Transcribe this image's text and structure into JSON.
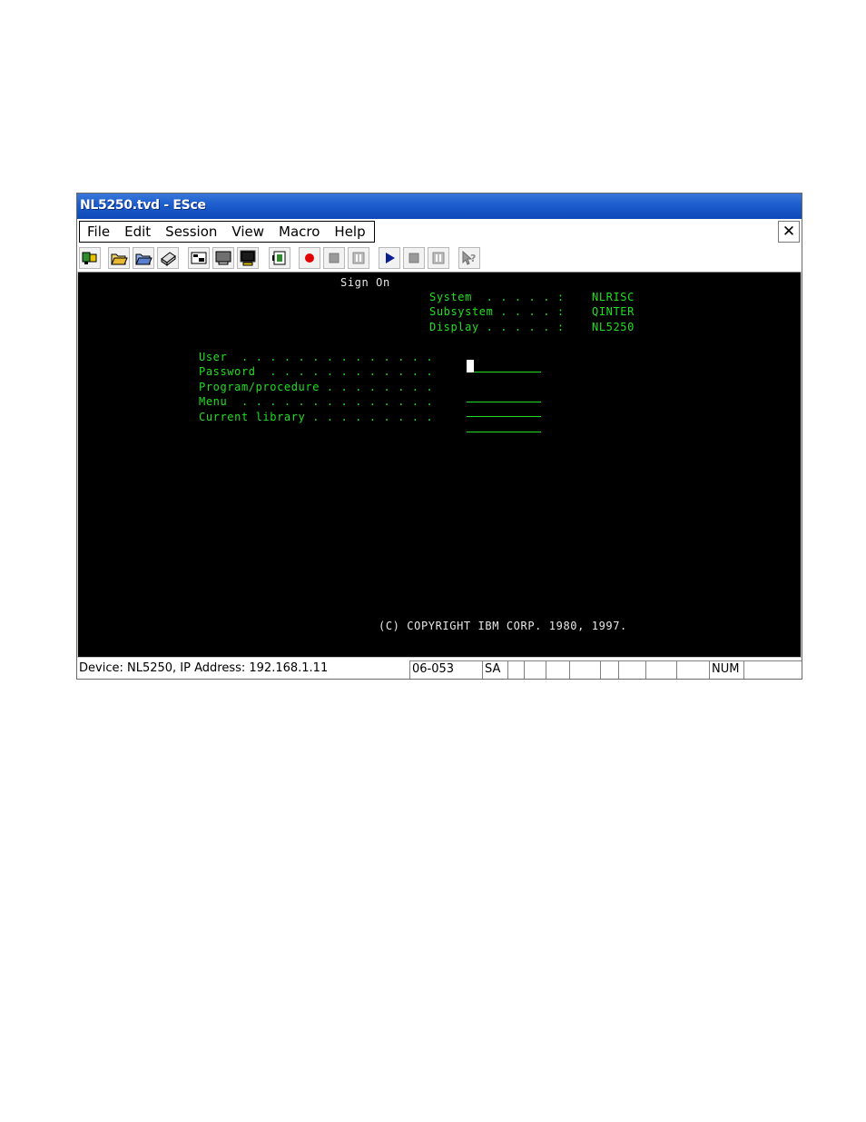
{
  "window": {
    "title": "NL5250.tvd - ESce"
  },
  "menu": {
    "items": [
      "File",
      "Edit",
      "Session",
      "View",
      "Macro",
      "Help"
    ],
    "close_label": "✕"
  },
  "toolbar": {
    "buttons": [
      "connect-icon",
      "open-folder-icon",
      "open-session-icon",
      "print-icon",
      "copy-screen-icon",
      "display-icon",
      "monitor-icon",
      "keyboard-icon",
      "record-icon",
      "stop-record-icon",
      "pause-record-icon",
      "play-icon",
      "stop-icon",
      "pause-icon",
      "help-icon"
    ]
  },
  "terminal": {
    "heading": "Sign On",
    "info": [
      {
        "label": "System  . . . . . :",
        "value": "NLRISC"
      },
      {
        "label": "Subsystem . . . . :",
        "value": "QINTER"
      },
      {
        "label": "Display . . . . . :",
        "value": "NL5250"
      }
    ],
    "fields": [
      {
        "label": "User  . . . . . . . . . . . . . .",
        "value": ""
      },
      {
        "label": "Password  . . . . . . . . . . . .",
        "value": ""
      },
      {
        "label": "Program/procedure . . . . . . . .",
        "value": ""
      },
      {
        "label": "Menu  . . . . . . . . . . . . . .",
        "value": ""
      },
      {
        "label": "Current library . . . . . . . . .",
        "value": ""
      }
    ],
    "copyright": "(C) COPYRIGHT IBM CORP. 1980, 1997.",
    "text_color": "#22dd22"
  },
  "status": {
    "device": "Device: NL5250, IP Address: 192.168.1.11",
    "position": "06-053",
    "mode": "SA",
    "num": "NUM"
  }
}
